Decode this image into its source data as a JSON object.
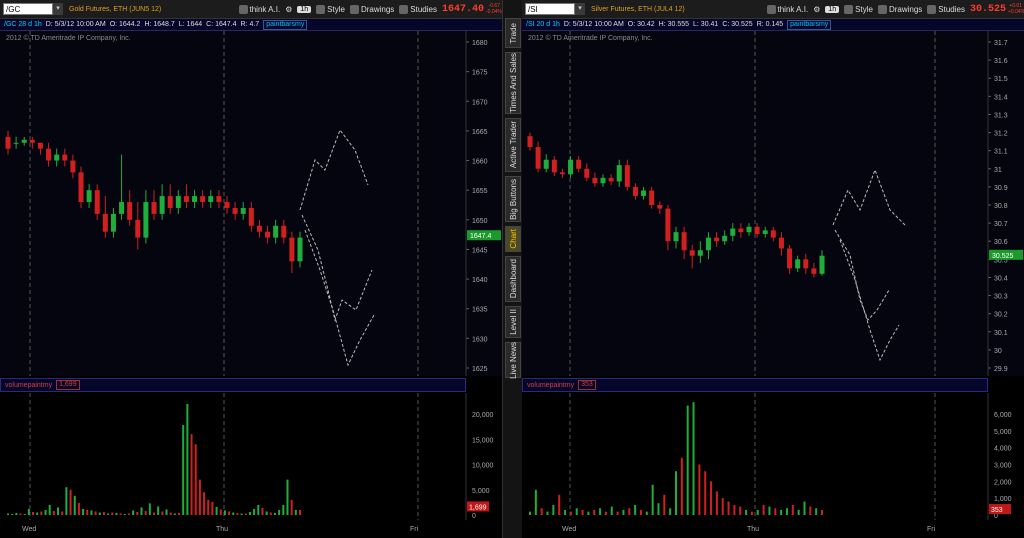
{
  "panels": [
    {
      "symbol": "/GC",
      "description": "Gold Futures, ETH (JUN5 12)",
      "last_price": "1647.40",
      "change_top": "-0.67",
      "change_bottom": "-0.04%",
      "think_label": "think A.I.",
      "aggregation": "1h",
      "style_label": "Style",
      "drawings_label": "Drawings",
      "studies_label": "Studies",
      "header": {
        "period": "/GC 28 d 1h",
        "date": "D: 5/3/12 10:00 AM",
        "open": "O: 1644.2",
        "high": "H: 1648.7",
        "low": "L: 1644",
        "close": "C: 1647.4",
        "range": "R: 4.7",
        "study": "paintbarsmy"
      },
      "copyright": "2012 © TD Ameritrade IP Company, Inc.",
      "price_axis": [
        "1680",
        "1675",
        "1670",
        "1665",
        "1660",
        "1655",
        "1650",
        "1645",
        "1640",
        "1635",
        "1630",
        "1625"
      ],
      "price_tag": "1647.4",
      "volume": {
        "name": "volumepaintmy",
        "value": "1,699",
        "axis": [
          "20,000",
          "15,000",
          "10,000",
          "5,000",
          "0"
        ],
        "tag": "1,699"
      },
      "days": [
        "Wed",
        "Thu",
        "Fri"
      ],
      "colors": {
        "up": "#1fae3c",
        "down": "#d21f1f",
        "tag": "#1a9a2a"
      },
      "candles_price_range": [
        1625,
        1681
      ],
      "candles": [
        [
          1664,
          1662,
          1665,
          1661
        ],
        [
          1663,
          1663,
          1664,
          1662
        ],
        [
          1663,
          1663.5,
          1664,
          1662.5
        ],
        [
          1663.5,
          1663,
          1664,
          1662
        ],
        [
          1663,
          1662,
          1663,
          1661
        ],
        [
          1662,
          1660,
          1663,
          1659
        ],
        [
          1660,
          1661,
          1662,
          1659
        ],
        [
          1661,
          1660,
          1662,
          1659
        ],
        [
          1660,
          1658,
          1661,
          1657
        ],
        [
          1658,
          1653,
          1659,
          1652
        ],
        [
          1653,
          1655,
          1656,
          1652
        ],
        [
          1655,
          1651,
          1656,
          1650
        ],
        [
          1651,
          1648,
          1654,
          1647
        ],
        [
          1648,
          1651,
          1652,
          1647
        ],
        [
          1651,
          1653,
          1661,
          1650
        ],
        [
          1653,
          1650,
          1655,
          1649
        ],
        [
          1650,
          1647,
          1653,
          1645
        ],
        [
          1647,
          1653,
          1655,
          1646
        ],
        [
          1653,
          1651,
          1655,
          1650
        ],
        [
          1651,
          1654,
          1656,
          1650
        ],
        [
          1654,
          1652,
          1656,
          1651
        ],
        [
          1652,
          1654,
          1655,
          1651
        ],
        [
          1654,
          1653,
          1656,
          1652
        ],
        [
          1653,
          1654,
          1655,
          1652
        ],
        [
          1654,
          1653,
          1655,
          1652
        ],
        [
          1653,
          1654,
          1655,
          1652
        ],
        [
          1654,
          1653,
          1655,
          1652
        ],
        [
          1653,
          1652,
          1654,
          1651
        ],
        [
          1652,
          1651,
          1653,
          1650
        ],
        [
          1651,
          1652,
          1653,
          1650
        ],
        [
          1652,
          1649,
          1653,
          1648
        ],
        [
          1649,
          1648,
          1650,
          1647
        ],
        [
          1648,
          1647,
          1649,
          1646
        ],
        [
          1647,
          1649,
          1650,
          1646
        ],
        [
          1649,
          1647,
          1650,
          1646
        ],
        [
          1647,
          1643,
          1648,
          1641
        ],
        [
          1643,
          1647,
          1648,
          1642
        ]
      ],
      "vol_max": 24000,
      "volumes": [
        [
          300,
          0
        ],
        [
          200,
          0
        ],
        [
          400,
          0
        ],
        [
          300,
          1
        ],
        [
          200,
          0
        ],
        [
          1200,
          0
        ],
        [
          600,
          1
        ],
        [
          500,
          0
        ],
        [
          700,
          1
        ],
        [
          1000,
          0
        ],
        [
          2000,
          0
        ],
        [
          800,
          1
        ],
        [
          1500,
          0
        ],
        [
          700,
          1
        ],
        [
          5500,
          0
        ],
        [
          5000,
          1
        ],
        [
          3800,
          0
        ],
        [
          2400,
          1
        ],
        [
          1200,
          0
        ],
        [
          1000,
          1
        ],
        [
          900,
          0
        ],
        [
          700,
          1
        ],
        [
          500,
          0
        ],
        [
          600,
          1
        ],
        [
          300,
          0
        ],
        [
          500,
          1
        ],
        [
          400,
          0
        ],
        [
          300,
          1
        ],
        [
          200,
          0
        ],
        [
          300,
          1
        ],
        [
          900,
          0
        ],
        [
          600,
          1
        ],
        [
          1500,
          0
        ],
        [
          800,
          1
        ],
        [
          2300,
          0
        ],
        [
          500,
          1
        ],
        [
          1700,
          0
        ],
        [
          700,
          1
        ],
        [
          1100,
          0
        ],
        [
          500,
          1
        ],
        [
          300,
          0
        ],
        [
          400,
          1
        ],
        [
          17800,
          0
        ],
        [
          22000,
          0
        ],
        [
          16000,
          1
        ],
        [
          14000,
          1
        ],
        [
          7000,
          1
        ],
        [
          4500,
          1
        ],
        [
          3000,
          1
        ],
        [
          2600,
          1
        ],
        [
          1600,
          0
        ],
        [
          1100,
          1
        ],
        [
          900,
          0
        ],
        [
          700,
          1
        ],
        [
          500,
          0
        ],
        [
          400,
          1
        ],
        [
          300,
          0
        ],
        [
          300,
          1
        ],
        [
          600,
          0
        ],
        [
          1200,
          0
        ],
        [
          2000,
          0
        ],
        [
          1400,
          1
        ],
        [
          700,
          0
        ],
        [
          500,
          1
        ],
        [
          400,
          0
        ],
        [
          1000,
          0
        ],
        [
          2000,
          0
        ],
        [
          7000,
          0
        ],
        [
          3000,
          1
        ],
        [
          1000,
          0
        ],
        [
          1000,
          1
        ]
      ]
    },
    {
      "symbol": "/SI",
      "description": "Silver Futures, ETH (JUL4 12)",
      "last_price": "30.525",
      "change_top": "+0.01",
      "change_bottom": "+0.04%",
      "think_label": "think A.I.",
      "aggregation": "1h",
      "style_label": "Style",
      "drawings_label": "Drawings",
      "studies_label": "Studies",
      "header": {
        "period": "/SI 20 d 1h",
        "date": "D: 5/3/12 10:00 AM",
        "open": "O: 30.42",
        "high": "H: 30.555",
        "low": "L: 30.41",
        "close": "C: 30.525",
        "range": "R: 0.145",
        "study": "paintbarsmy"
      },
      "copyright": "2012 © TD Ameritrade IP Company, Inc.",
      "price_axis": [
        "31.7",
        "31.6",
        "31.5",
        "31.4",
        "31.3",
        "31.2",
        "31.1",
        "31",
        "30.9",
        "30.8",
        "30.7",
        "30.6",
        "30.5",
        "30.4",
        "30.3",
        "30.2",
        "30.1",
        "30",
        "29.9"
      ],
      "price_tag": "30.525",
      "volume": {
        "name": "volumepaintmy",
        "value": "353",
        "axis": [
          "6,000",
          "5,000",
          "4,000",
          "3,000",
          "2,000",
          "1,000",
          "0"
        ],
        "tag": "353"
      },
      "days": [
        "Wed",
        "Thu",
        "Fri"
      ],
      "colors": {
        "up": "#1fae3c",
        "down": "#d21f1f",
        "tag": "#1a9a2a"
      },
      "candles_price_range": [
        29.85,
        31.78
      ],
      "candles": [
        [
          31.18,
          31.12,
          31.2,
          31.1
        ],
        [
          31.12,
          31.0,
          31.15,
          30.98
        ],
        [
          31.0,
          31.05,
          31.08,
          30.98
        ],
        [
          31.05,
          30.98,
          31.07,
          30.96
        ],
        [
          30.98,
          30.97,
          31.0,
          30.95
        ],
        [
          30.97,
          31.05,
          31.07,
          30.95
        ],
        [
          31.05,
          31.0,
          31.07,
          30.98
        ],
        [
          31.0,
          30.95,
          31.03,
          30.93
        ],
        [
          30.95,
          30.92,
          30.98,
          30.9
        ],
        [
          30.92,
          30.95,
          30.97,
          30.9
        ],
        [
          30.95,
          30.93,
          30.97,
          30.91
        ],
        [
          30.93,
          31.02,
          31.05,
          30.9
        ],
        [
          31.02,
          30.9,
          31.05,
          30.88
        ],
        [
          30.9,
          30.85,
          30.92,
          30.83
        ],
        [
          30.85,
          30.88,
          30.9,
          30.83
        ],
        [
          30.88,
          30.8,
          30.9,
          30.78
        ],
        [
          30.8,
          30.78,
          30.82,
          30.75
        ],
        [
          30.78,
          30.6,
          30.8,
          30.55
        ],
        [
          30.6,
          30.65,
          30.68,
          30.56
        ],
        [
          30.65,
          30.55,
          30.68,
          30.5
        ],
        [
          30.55,
          30.52,
          30.58,
          30.45
        ],
        [
          30.52,
          30.55,
          30.6,
          30.48
        ],
        [
          30.55,
          30.62,
          30.65,
          30.5
        ],
        [
          30.62,
          30.6,
          30.65,
          30.57
        ],
        [
          30.6,
          30.63,
          30.66,
          30.58
        ],
        [
          30.63,
          30.67,
          30.7,
          30.6
        ],
        [
          30.67,
          30.65,
          30.7,
          30.62
        ],
        [
          30.65,
          30.68,
          30.7,
          30.63
        ],
        [
          30.68,
          30.64,
          30.7,
          30.62
        ],
        [
          30.64,
          30.66,
          30.68,
          30.62
        ],
        [
          30.66,
          30.62,
          30.68,
          30.6
        ],
        [
          30.62,
          30.56,
          30.65,
          30.52
        ],
        [
          30.56,
          30.45,
          30.58,
          30.42
        ],
        [
          30.45,
          30.5,
          30.52,
          30.43
        ],
        [
          30.5,
          30.45,
          30.53,
          30.42
        ],
        [
          30.45,
          30.42,
          30.48,
          30.4
        ],
        [
          30.42,
          30.52,
          30.55,
          30.41
        ]
      ],
      "vol_max": 6800,
      "volumes": [
        [
          200,
          0
        ],
        [
          1500,
          0
        ],
        [
          400,
          1
        ],
        [
          200,
          0
        ],
        [
          600,
          0
        ],
        [
          1200,
          1
        ],
        [
          300,
          0
        ],
        [
          200,
          1
        ],
        [
          400,
          0
        ],
        [
          300,
          1
        ],
        [
          200,
          0
        ],
        [
          300,
          1
        ],
        [
          400,
          0
        ],
        [
          200,
          1
        ],
        [
          500,
          0
        ],
        [
          200,
          1
        ],
        [
          300,
          0
        ],
        [
          400,
          1
        ],
        [
          600,
          0
        ],
        [
          300,
          1
        ],
        [
          200,
          0
        ],
        [
          1800,
          0
        ],
        [
          700,
          0
        ],
        [
          1200,
          1
        ],
        [
          400,
          0
        ],
        [
          2600,
          0
        ],
        [
          3400,
          1
        ],
        [
          6500,
          0
        ],
        [
          6700,
          0
        ],
        [
          3000,
          1
        ],
        [
          2600,
          1
        ],
        [
          2000,
          1
        ],
        [
          1400,
          1
        ],
        [
          1000,
          1
        ],
        [
          800,
          1
        ],
        [
          600,
          1
        ],
        [
          500,
          1
        ],
        [
          300,
          0
        ],
        [
          200,
          1
        ],
        [
          300,
          0
        ],
        [
          600,
          1
        ],
        [
          500,
          0
        ],
        [
          400,
          1
        ],
        [
          300,
          0
        ],
        [
          400,
          0
        ],
        [
          600,
          1
        ],
        [
          300,
          0
        ],
        [
          800,
          0
        ],
        [
          500,
          1
        ],
        [
          400,
          0
        ],
        [
          300,
          1
        ]
      ]
    }
  ],
  "side_tabs": [
    "Trade",
    "Times And Sales",
    "Active Trader",
    "Big Buttons",
    "Chart",
    "Dashboard",
    "Level II",
    "Live News"
  ],
  "active_side_tab": "Chart"
}
